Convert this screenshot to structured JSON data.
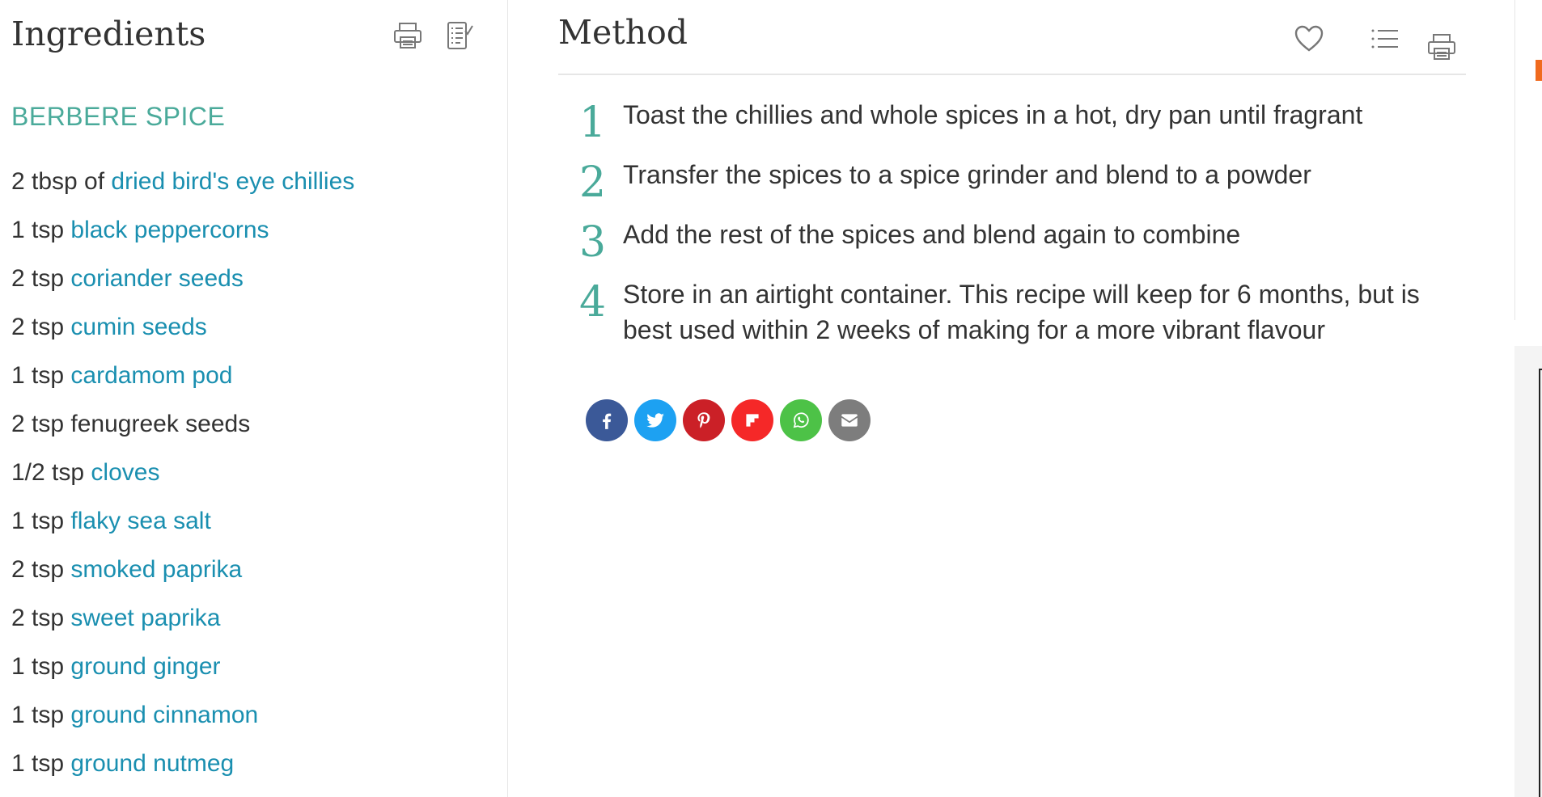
{
  "ingredients": {
    "title": "Ingredients",
    "print_icon": "printer-icon",
    "shopping_list_icon": "checklist-icon",
    "section_heading": "BERBERE SPICE",
    "items": [
      {
        "qty": "2 tbsp of",
        "name": "dried bird's eye chillies",
        "linked": true
      },
      {
        "qty": "1 tsp",
        "name": "black peppercorns",
        "linked": true
      },
      {
        "qty": "2 tsp",
        "name": "coriander seeds",
        "linked": true
      },
      {
        "qty": "2 tsp",
        "name": "cumin seeds",
        "linked": true
      },
      {
        "qty": "1 tsp",
        "name": "cardamom pod",
        "linked": true
      },
      {
        "qty": "2 tsp",
        "name": "fenugreek seeds",
        "linked": false
      },
      {
        "qty": "1/2 tsp",
        "name": "cloves",
        "linked": true
      },
      {
        "qty": "1 tsp",
        "name": "flaky sea salt",
        "linked": true
      },
      {
        "qty": "2 tsp",
        "name": "smoked paprika",
        "linked": true
      },
      {
        "qty": "2 tsp",
        "name": "sweet paprika",
        "linked": true
      },
      {
        "qty": "1 tsp",
        "name": "ground ginger",
        "linked": true
      },
      {
        "qty": "1 tsp",
        "name": "ground cinnamon",
        "linked": true
      },
      {
        "qty": "1 tsp",
        "name": "ground nutmeg",
        "linked": true
      }
    ]
  },
  "method": {
    "title": "Method",
    "favourite_icon": "heart-icon",
    "list_icon": "list-icon",
    "print_icon": "printer-icon",
    "steps": [
      {
        "number": "1",
        "text": "Toast the chillies and whole spices in a hot, dry pan until fragrant"
      },
      {
        "number": "2",
        "text": "Transfer the spices to a spice grinder and blend to a powder"
      },
      {
        "number": "3",
        "text": "Add the rest of the spices and blend again to combine"
      },
      {
        "number": "4",
        "text": "Store in an airtight container. This recipe will keep for 6 months, but is best used within 2 weeks of making for a more vibrant flavour"
      }
    ]
  },
  "share": [
    {
      "network": "facebook",
      "icon": "facebook-icon",
      "color": "#3b5998"
    },
    {
      "network": "twitter",
      "icon": "twitter-icon",
      "color": "#1da1f2"
    },
    {
      "network": "pinterest",
      "icon": "pinterest-icon",
      "color": "#cb2027"
    },
    {
      "network": "flipboard",
      "icon": "flipboard-icon",
      "color": "#f52828"
    },
    {
      "network": "whatsapp",
      "icon": "whatsapp-icon",
      "color": "#4dc247"
    },
    {
      "network": "email",
      "icon": "email-icon",
      "color": "#7d7d7d"
    }
  ],
  "colors": {
    "accent_teal": "#4aaa9a",
    "link_blue": "#1a8fb0",
    "text": "#333333",
    "divider": "#e6e6e6"
  }
}
